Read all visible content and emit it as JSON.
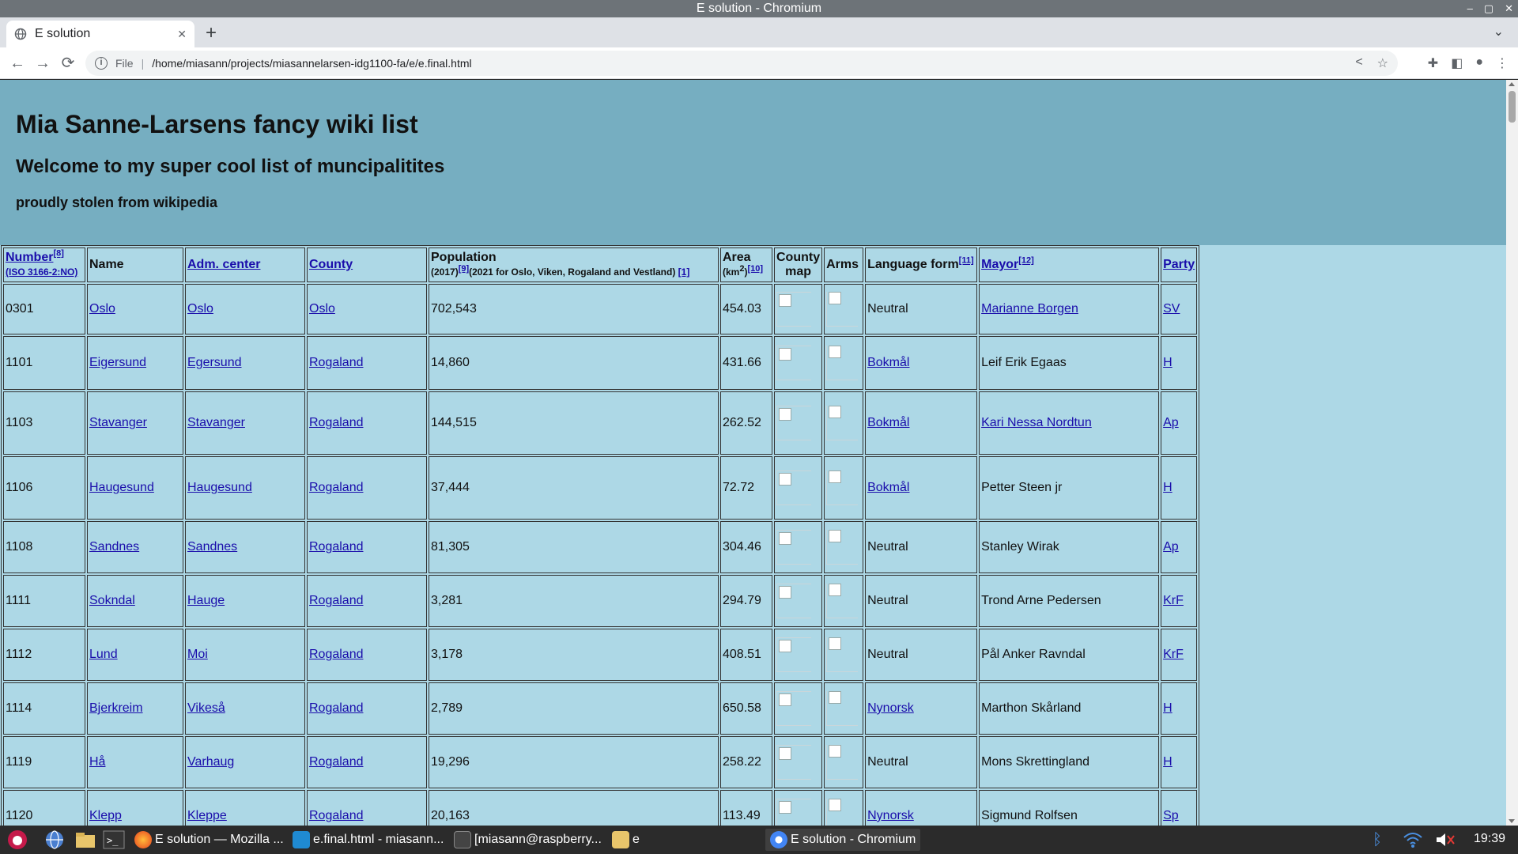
{
  "window": {
    "title": "E solution - Chromium",
    "controls": [
      "–",
      "▢",
      "✕"
    ]
  },
  "tab": {
    "title": "E solution",
    "close": "✕",
    "new_tab": "+"
  },
  "toolbar": {
    "back": "←",
    "forward": "→",
    "reload": "⟳",
    "info": "i",
    "scheme": "File",
    "url": "/home/miasann/projects/miasannelarsen-idg1100-fa/e/e.final.html"
  },
  "page": {
    "h1": "Mia Sanne-Larsens fancy wiki list",
    "h2": "Welcome to my super cool list of muncipalitites",
    "h3": "proudly stolen from wikipedia"
  },
  "table": {
    "headers": {
      "number": "Number",
      "number_ref": "[8]",
      "number_sub": "(ISO 3166-2:NO)",
      "name": "Name",
      "adm_center": "Adm. center",
      "county": "County",
      "population": "Population",
      "population_year": "(2017)",
      "population_ref": "[9]",
      "population_note": "(2021 for Oslo, Viken, Rogaland and Vestland)",
      "population_note_ref": "[1]",
      "area": "Area",
      "area_unit_pre": "(km",
      "area_unit_sup": "2",
      "area_unit_post": ")",
      "area_ref": "[10]",
      "county_map_1": "County",
      "county_map_2": "map",
      "arms": "Arms",
      "language_form": "Language form",
      "language_ref": "[11]",
      "mayor": "Mayor",
      "mayor_ref": "[12]",
      "party": "Party"
    },
    "rows": [
      {
        "number": "0301",
        "name": "Oslo",
        "adm": "Oslo",
        "county": "Oslo",
        "population": "702,543",
        "area": "454.03",
        "language": "Neutral",
        "language_link": false,
        "mayor": "Marianne Borgen",
        "mayor_link": true,
        "party": "SV"
      },
      {
        "number": "1101",
        "name": "Eigersund",
        "adm": "Egersund",
        "county": "Rogaland",
        "population": "14,860",
        "area": "431.66",
        "language": "Bokmål",
        "language_link": true,
        "mayor": "Leif Erik Egaas",
        "mayor_link": false,
        "party": "H"
      },
      {
        "number": "1103",
        "name": "Stavanger",
        "adm": "Stavanger",
        "county": "Rogaland",
        "population": "144,515",
        "area": "262.52",
        "language": "Bokmål",
        "language_link": true,
        "mayor": "Kari Nessa Nordtun",
        "mayor_link": true,
        "party": "Ap"
      },
      {
        "number": "1106",
        "name": "Haugesund",
        "adm": "Haugesund",
        "county": "Rogaland",
        "population": "37,444",
        "area": "72.72",
        "language": "Bokmål",
        "language_link": true,
        "mayor": "Petter Steen jr",
        "mayor_link": false,
        "party": "H"
      },
      {
        "number": "1108",
        "name": "Sandnes",
        "adm": "Sandnes",
        "county": "Rogaland",
        "population": "81,305",
        "area": "304.46",
        "language": "Neutral",
        "language_link": false,
        "mayor": "Stanley Wirak",
        "mayor_link": false,
        "party": "Ap"
      },
      {
        "number": "1111",
        "name": "Sokndal",
        "adm": "Hauge",
        "county": "Rogaland",
        "population": "3,281",
        "area": "294.79",
        "language": "Neutral",
        "language_link": false,
        "mayor": "Trond Arne Pedersen",
        "mayor_link": false,
        "party": "KrF"
      },
      {
        "number": "1112",
        "name": "Lund",
        "adm": "Moi",
        "county": "Rogaland",
        "population": "3,178",
        "area": "408.51",
        "language": "Neutral",
        "language_link": false,
        "mayor": "Pål Anker Ravndal",
        "mayor_link": false,
        "party": "KrF"
      },
      {
        "number": "1114",
        "name": "Bjerkreim",
        "adm": "Vikeså",
        "county": "Rogaland",
        "population": "2,789",
        "area": "650.58",
        "language": "Nynorsk",
        "language_link": true,
        "mayor": "Marthon Skårland",
        "mayor_link": false,
        "party": "H"
      },
      {
        "number": "1119",
        "name": "Hå",
        "adm": "Varhaug",
        "county": "Rogaland",
        "population": "19,296",
        "area": "258.22",
        "language": "Neutral",
        "language_link": false,
        "mayor": "Mons Skrettingland",
        "mayor_link": false,
        "party": "H"
      },
      {
        "number": "1120",
        "name": "Klepp",
        "adm": "Kleppe",
        "county": "Rogaland",
        "population": "20,163",
        "area": "113.49",
        "language": "Nynorsk",
        "language_link": true,
        "mayor": "Sigmund Rolfsen",
        "mayor_link": false,
        "party": "Sp"
      }
    ]
  },
  "taskbar": {
    "items": [
      {
        "label": "E solution — Mozilla ...",
        "icon": "firefox-icon"
      },
      {
        "label": "e.final.html - miasann...",
        "icon": "vscode-icon"
      },
      {
        "label": "[miasann@raspberry...",
        "icon": "terminal-icon"
      },
      {
        "label": "e",
        "icon": "folder-icon"
      },
      {
        "label": "E solution - Chromium",
        "icon": "chromium-icon"
      }
    ],
    "clock": "19:39"
  }
}
